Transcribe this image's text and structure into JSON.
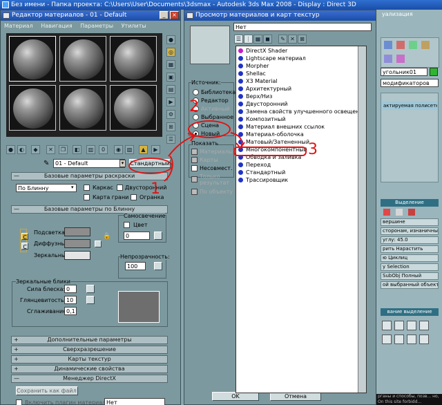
{
  "top_bar": {
    "title": "Без имени    - Папка проекта: C:\\Users\\User\\Documents\\3dsmax    - Autodesk 3ds Max 2008    - Display : Direct 3D"
  },
  "bg_right": {
    "title_fragment": "уализация",
    "object_name": "угольник01",
    "modifier_list": "модификаторов",
    "modifier_item": "актируемая полисетка",
    "selection_header": "Выделение",
    "lines": [
      "вершине",
      "сторонам, изнаничные",
      "углу: 45.0",
      "рить  Нарастить",
      "ю  Циклиц",
      "y Selection",
      "SubObj  Полный",
      "ой выбранный объект"
    ],
    "soft_header": "вание выделение",
    "footer_text": "рганы и способы, позв... но, On this site forbidd..."
  },
  "material_editor": {
    "title": "Редактор материалов - 01 - Default",
    "menu": [
      "Материал",
      "Навигация",
      "Параметры",
      "Утилиты"
    ],
    "material_name": "01 - Default",
    "type_button": "Стандартный",
    "rollouts": {
      "shader": "Базовые параметры раскраски",
      "blinn": "Базовые параметры по Блинну",
      "extended": "Дополнительные параметры",
      "supersampling": "Сверхразрешение",
      "maps": "Карты текстур",
      "dynamics": "Динамические свойства",
      "directx": "Менеджер DirectX"
    },
    "shader": {
      "type": "По Блинну",
      "wire": "Каркас",
      "two_sided": "Двусторонний",
      "face_map": "Карта грани",
      "faceted": "Огранка"
    },
    "blinn": {
      "ambient": "Подсветка:",
      "diffuse": "Диффузный:",
      "specular": "Зеркальный:",
      "self_illum": "Самосвечение",
      "color": "Цвет",
      "self_illum_value": "0",
      "opacity": "Непрозрачность:",
      "opacity_value": "100"
    },
    "specular": {
      "group": "Зеркальные блики",
      "level": "Сила блеска:",
      "level_value": "0",
      "gloss": "Глянцевитость:",
      "gloss_value": "10",
      "soften": "Сглаживание:",
      "soften_value": "0,1"
    },
    "directx": {
      "save_fx": "Сохранить как файл FX",
      "plugin_label": "Включить плагин материалов",
      "plugin_value": "Нет"
    }
  },
  "browser": {
    "title": "Просмотр материалов и карт текстур",
    "search_value": "Нет",
    "source": {
      "label": "Источник:",
      "options": [
        "Библиотека",
        "Редактор",
        "Активный",
        "Выбранное",
        "Сцена",
        "Новый"
      ]
    },
    "show": {
      "label": "Показать",
      "options": [
        "Материалы",
        "Карты",
        "Несовмест."
      ]
    },
    "extra": [
      "Только результат",
      "По объекту"
    ],
    "items": [
      "DirectX Shader",
      "Lightscape материал",
      "Morpher",
      "Shellac",
      "X3 Material",
      "Архитектурный",
      "Верх/Низ",
      "Двусторонний",
      "Замена свойств улучшенного освещения",
      "Композитный",
      "Материал внешних ссылок",
      "Материал-оболочка",
      "Матовый/Затененный",
      "Многокомпонентный",
      "Обводка и заливка",
      "Переход",
      "Стандартный",
      "Трассировщик"
    ],
    "ok": "OK",
    "cancel": "Отмена"
  },
  "annotations": {
    "n1": "1",
    "n2": "2",
    "n3": "3"
  },
  "colors": {
    "accent_red": "#e01414",
    "dot_blue": "#1f33c6",
    "dot_purple": "#c21ec8"
  }
}
